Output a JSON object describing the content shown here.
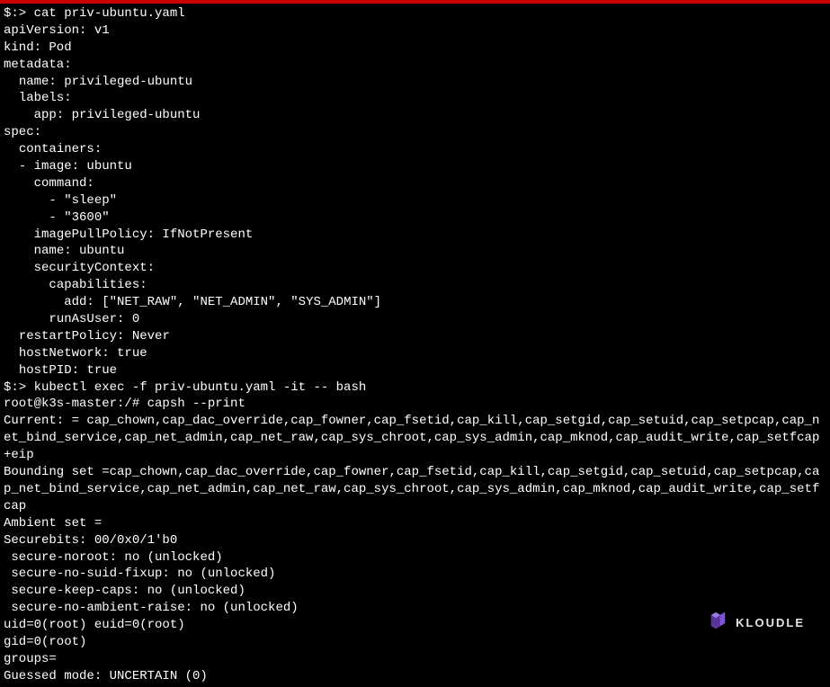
{
  "terminal": {
    "lines": [
      "$:> cat priv-ubuntu.yaml",
      "apiVersion: v1",
      "kind: Pod",
      "metadata:",
      "  name: privileged-ubuntu",
      "  labels:",
      "    app: privileged-ubuntu",
      "spec:",
      "  containers:",
      "  - image: ubuntu",
      "    command:",
      "      - \"sleep\"",
      "      - \"3600\"",
      "    imagePullPolicy: IfNotPresent",
      "    name: ubuntu",
      "    securityContext:",
      "      capabilities:",
      "        add: [\"NET_RAW\", \"NET_ADMIN\", \"SYS_ADMIN\"]",
      "      runAsUser: 0",
      "  restartPolicy: Never",
      "  hostNetwork: true",
      "  hostPID: true",
      "$:> kubectl exec -f priv-ubuntu.yaml -it -- bash",
      "root@k3s-master:/# capsh --print",
      "Current: = cap_chown,cap_dac_override,cap_fowner,cap_fsetid,cap_kill,cap_setgid,cap_setuid,cap_setpcap,cap_net_bind_service,cap_net_admin,cap_net_raw,cap_sys_chroot,cap_sys_admin,cap_mknod,cap_audit_write,cap_setfcap+eip",
      "Bounding set =cap_chown,cap_dac_override,cap_fowner,cap_fsetid,cap_kill,cap_setgid,cap_setuid,cap_setpcap,cap_net_bind_service,cap_net_admin,cap_net_raw,cap_sys_chroot,cap_sys_admin,cap_mknod,cap_audit_write,cap_setfcap",
      "Ambient set =",
      "Securebits: 00/0x0/1'b0",
      " secure-noroot: no (unlocked)",
      " secure-no-suid-fixup: no (unlocked)",
      " secure-keep-caps: no (unlocked)",
      " secure-no-ambient-raise: no (unlocked)",
      "uid=0(root) euid=0(root)",
      "gid=0(root)",
      "groups=",
      "Guessed mode: UNCERTAIN (0)"
    ]
  },
  "watermark": {
    "text": "KLOUDLE"
  }
}
